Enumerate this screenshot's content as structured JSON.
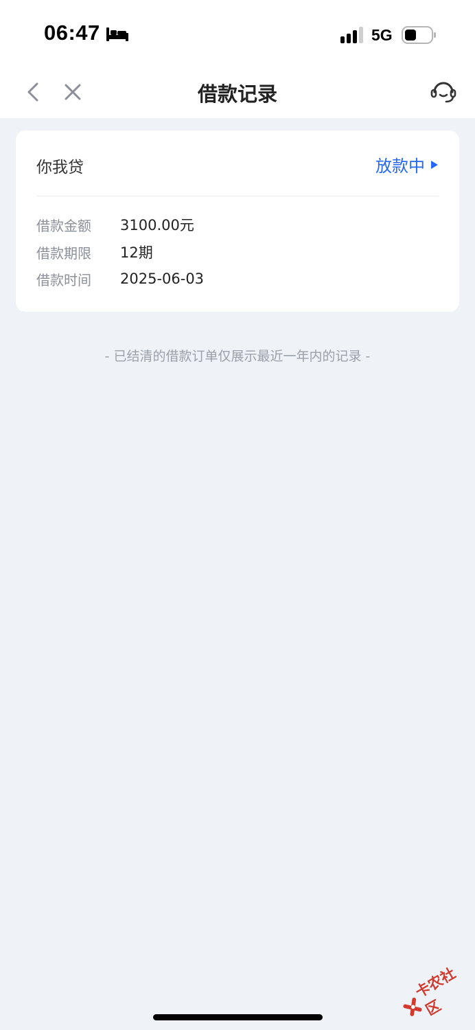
{
  "status_bar": {
    "time": "06:47",
    "network": "5G",
    "icons": [
      "bed-icon",
      "signal-icon",
      "battery-icon"
    ]
  },
  "nav": {
    "title": "借款记录",
    "icons": [
      "back-icon",
      "close-icon",
      "customer-service-icon"
    ]
  },
  "loan_card": {
    "lender": "你我贷",
    "status": "放款中",
    "details": [
      {
        "label": "借款金额",
        "value": "3100.00元"
      },
      {
        "label": "借款期限",
        "value": "12期"
      },
      {
        "label": "借款时间",
        "value": "2025-06-03"
      }
    ]
  },
  "footnote": "- 已结清的借款订单仅展示最近一年内的记录 -",
  "watermark": {
    "logo": "watermark-logo-icon"
  },
  "colors": {
    "accent": "#2468f2",
    "background": "#eff2f7",
    "card": "#ffffff",
    "label": "#8a8f99"
  }
}
